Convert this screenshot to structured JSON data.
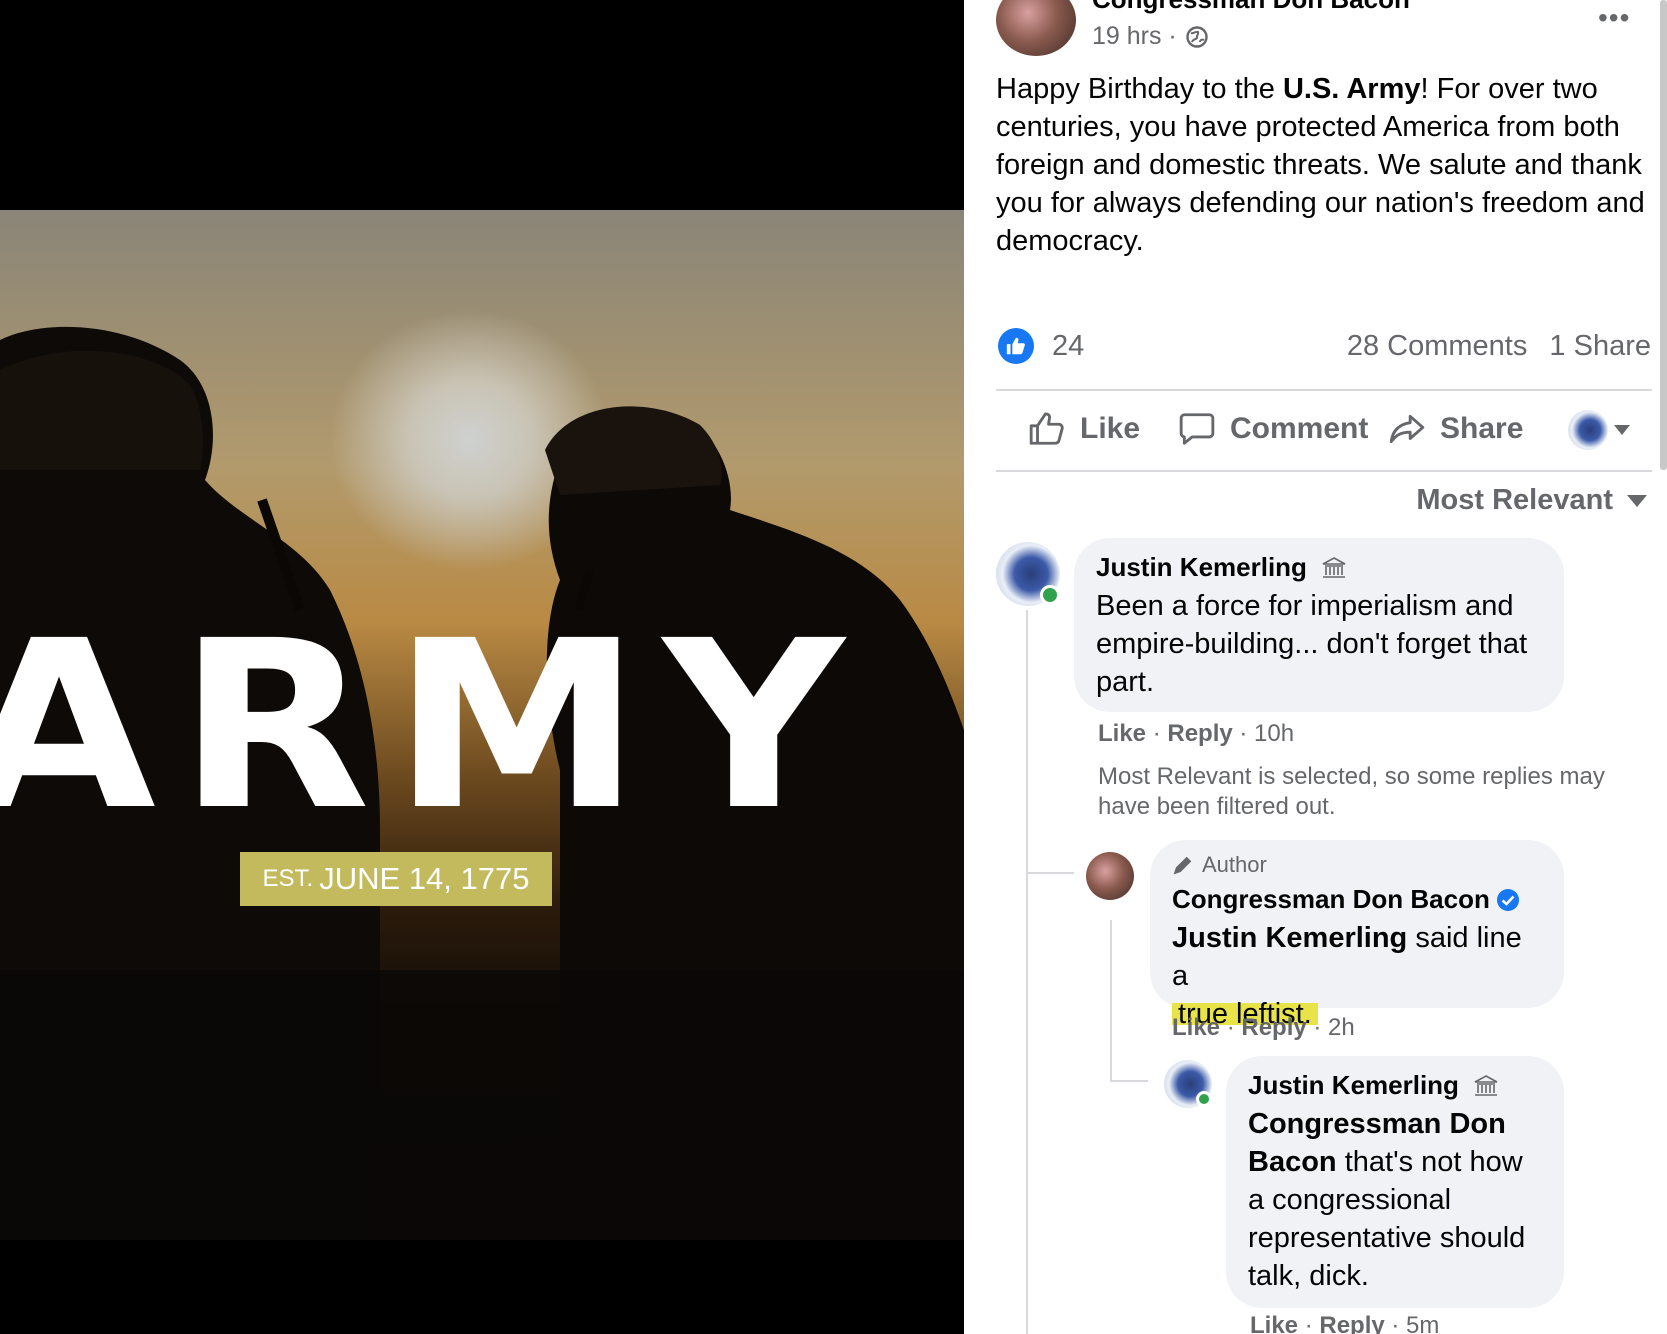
{
  "photo": {
    "headline": "ARMY",
    "badge_prefix": "EST.",
    "badge_date": "JUNE 14, 1775"
  },
  "post": {
    "author": "Congressman Don Bacon",
    "time": "19 hrs ·",
    "text_before": "Happy Birthday to the ",
    "text_bold": "U.S. Army",
    "text_after": "! For over two centuries, you have protected America from both foreign and domestic threats. We salute and thank you for always defending our nation's freedom and democracy.",
    "like_count": "24",
    "comments_count": "28 Comments",
    "shares_count": "1 Share"
  },
  "actions": {
    "like": "Like",
    "comment": "Comment",
    "share": "Share"
  },
  "sort": {
    "label": "Most Relevant"
  },
  "comments": [
    {
      "name": "Justin Kemerling",
      "text": "Been a force for imperialism and empire-building... don't forget that part.",
      "like": "Like",
      "reply": "Reply",
      "time": "10h"
    }
  ],
  "filter_notice": "Most Relevant is selected, so some replies may have been filtered out.",
  "replies": [
    {
      "badge": "Author",
      "name": "Congressman Don Bacon",
      "mention": "Justin Kemerling",
      "text_mid": " said line a",
      "text_highlight": "true leftist.",
      "like": "Like",
      "reply": "Reply",
      "time": "2h"
    },
    {
      "name": "Justin Kemerling",
      "mention": "Congressman Don Bacon",
      "text": " that's not how a congressional representative should talk, dick.",
      "like": "Like",
      "reply": "Reply",
      "time": "5m"
    }
  ],
  "colors": {
    "like_blue": "#1877f2",
    "verified_blue": "#1877f2",
    "highlight_yellow": "#e9e34a",
    "online_green": "#31a24c"
  }
}
